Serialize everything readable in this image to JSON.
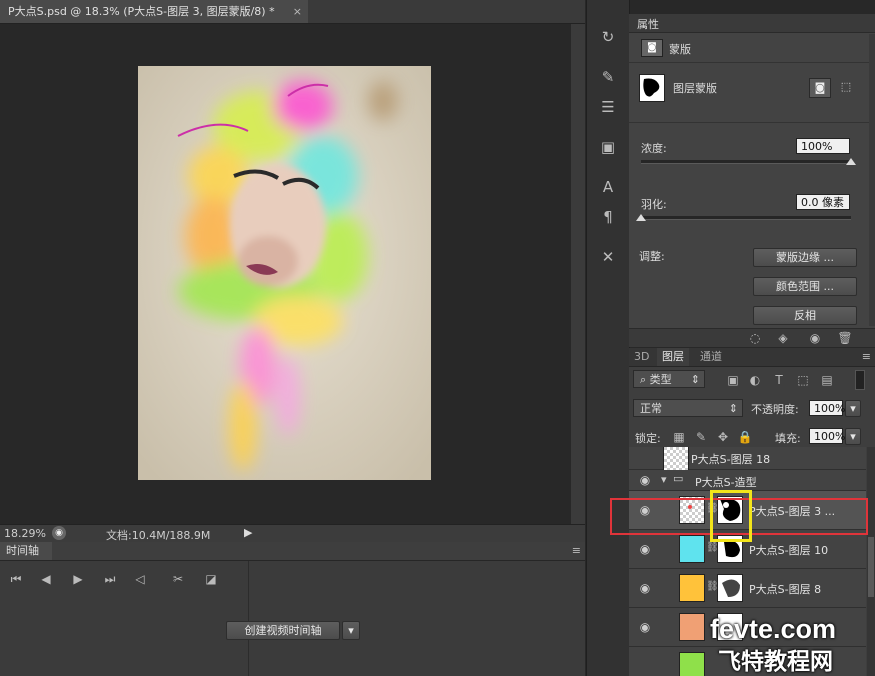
{
  "document": {
    "tab_title": "P大点S.psd @ 18.3% (P大点S-图层 3, 图层蒙版/8) *",
    "close_glyph": "×"
  },
  "status_bar": {
    "zoom": "18.29%",
    "doc_info": "文档:10.4M/188.9M"
  },
  "timeline": {
    "tab_label": "时间轴",
    "create_button": "创建视频时间轴"
  },
  "properties": {
    "title": "属性",
    "mask_label": "蒙版",
    "layer_mask_label": "图层蒙版",
    "density_label": "浓度:",
    "density_value": "100%",
    "density_level": 1.0,
    "feather_label": "羽化:",
    "feather_value": "0.0 像素",
    "feather_level": 0.0,
    "adjust_label": "调整:",
    "mask_edge_button": "蒙版边缘 ...",
    "color_range_button": "颜色范围 ...",
    "invert_button": "反相"
  },
  "layers_panel": {
    "tabs": [
      "3D",
      "图层",
      "通道"
    ],
    "filter_kind": "类型",
    "blend_mode": "正常",
    "opacity_label": "不透明度:",
    "opacity_value": "100%",
    "lock_label": "锁定:",
    "fill_label": "填充:",
    "fill_value": "100%",
    "layers": [
      {
        "name": "P大点S-图层 18",
        "type": "layer"
      },
      {
        "name": "P大点S-造型",
        "type": "group"
      },
      {
        "name": "P大点S-图层 3 ...",
        "type": "layer",
        "selected": true
      },
      {
        "name": "P大点S-图层 10",
        "type": "layer"
      },
      {
        "name": "P大点S-图层 8",
        "type": "layer"
      }
    ]
  },
  "watermark": {
    "line1": "fevte.com",
    "line2": "飞特教程网"
  },
  "colors": {
    "highlight_red": "#e0343a",
    "highlight_yellow": "#f3e51a"
  },
  "icons": {
    "eye": "eye-icon",
    "link": "chain-link-icon",
    "folder": "folder-icon"
  }
}
